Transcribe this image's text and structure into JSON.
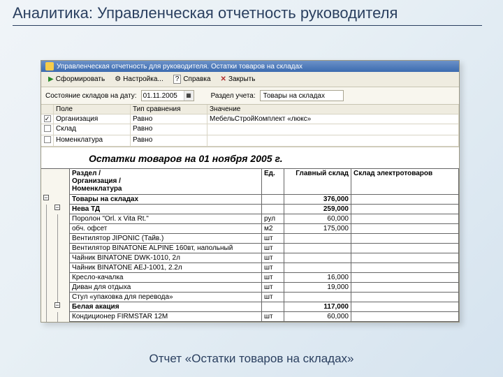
{
  "slide": {
    "title": "Аналитика: Управленческая отчетность руководителя",
    "caption": "Отчет «Остатки товаров на складах»"
  },
  "window": {
    "title": "Управленческая отчетность для руководителя. Остатки товаров на складах"
  },
  "toolbar": {
    "generate": "Сформировать",
    "settings": "Настройка...",
    "help": "Справка",
    "close": "Закрыть"
  },
  "filters": {
    "date_label": "Состояние складов на дату:",
    "date_value": "01.11.2005",
    "section_label": "Раздел учета:",
    "section_value": "Товары на складах",
    "head": {
      "c0": "",
      "c1": "Поле",
      "c2": "Тип сравнения",
      "c3": "Значение"
    },
    "rows": [
      {
        "checked": true,
        "field": "Организация",
        "cmp": "Равно",
        "value": "МебельСтройКомплект «люкс»"
      },
      {
        "checked": false,
        "field": "Склад",
        "cmp": "Равно",
        "value": ""
      },
      {
        "checked": false,
        "field": "Номенклатура",
        "cmp": "Равно",
        "value": ""
      }
    ]
  },
  "report": {
    "title": "Остатки товаров на 01 ноября 2005 г.",
    "head": {
      "name": "Раздел /\nОрганизация /\nНоменклатура",
      "unit": "Ед.",
      "col1": "Главный склад",
      "col2": "Склад электротоваров"
    },
    "rows": [
      {
        "t": "group0",
        "name": "Товары на складах",
        "unit": "",
        "v1": "376,000",
        "v2": ""
      },
      {
        "t": "group1",
        "name": "Нева ТД",
        "unit": "",
        "v1": "259,000",
        "v2": ""
      },
      {
        "t": "item",
        "name": "Поролон \"Orl. x Vita Rt.\"",
        "unit": "рул",
        "v1": "60,000",
        "v2": ""
      },
      {
        "t": "item",
        "name": "обч. офсет",
        "unit": "м2",
        "v1": "175,000",
        "v2": ""
      },
      {
        "t": "item",
        "name": "Вентилятор JIPONIC (Тайв.)",
        "unit": "шт",
        "v1": "",
        "v2": ""
      },
      {
        "t": "item",
        "name": "Вентилятор BINATONE ALPINE 160вт, напольный",
        "unit": "шт",
        "v1": "",
        "v2": ""
      },
      {
        "t": "item",
        "name": "Чайник BINATONE DWK-1010, 2л",
        "unit": "шт",
        "v1": "",
        "v2": ""
      },
      {
        "t": "item",
        "name": "Чайник BINATONE AEJ-1001, 2.2л",
        "unit": "шт",
        "v1": "",
        "v2": ""
      },
      {
        "t": "item",
        "name": "Кресло-качалка",
        "unit": "шт",
        "v1": "16,000",
        "v2": ""
      },
      {
        "t": "item",
        "name": "Диван для отдыха",
        "unit": "шт",
        "v1": "19,000",
        "v2": ""
      },
      {
        "t": "item",
        "name": "Стул «упаковка для перевода»",
        "unit": "шт",
        "v1": "",
        "v2": ""
      },
      {
        "t": "group1",
        "name": "Белая акация",
        "unit": "",
        "v1": "117,000",
        "v2": ""
      },
      {
        "t": "item",
        "name": "Кондиционер FIRMSTAR 12M",
        "unit": "шт",
        "v1": "60,000",
        "v2": ""
      }
    ]
  }
}
